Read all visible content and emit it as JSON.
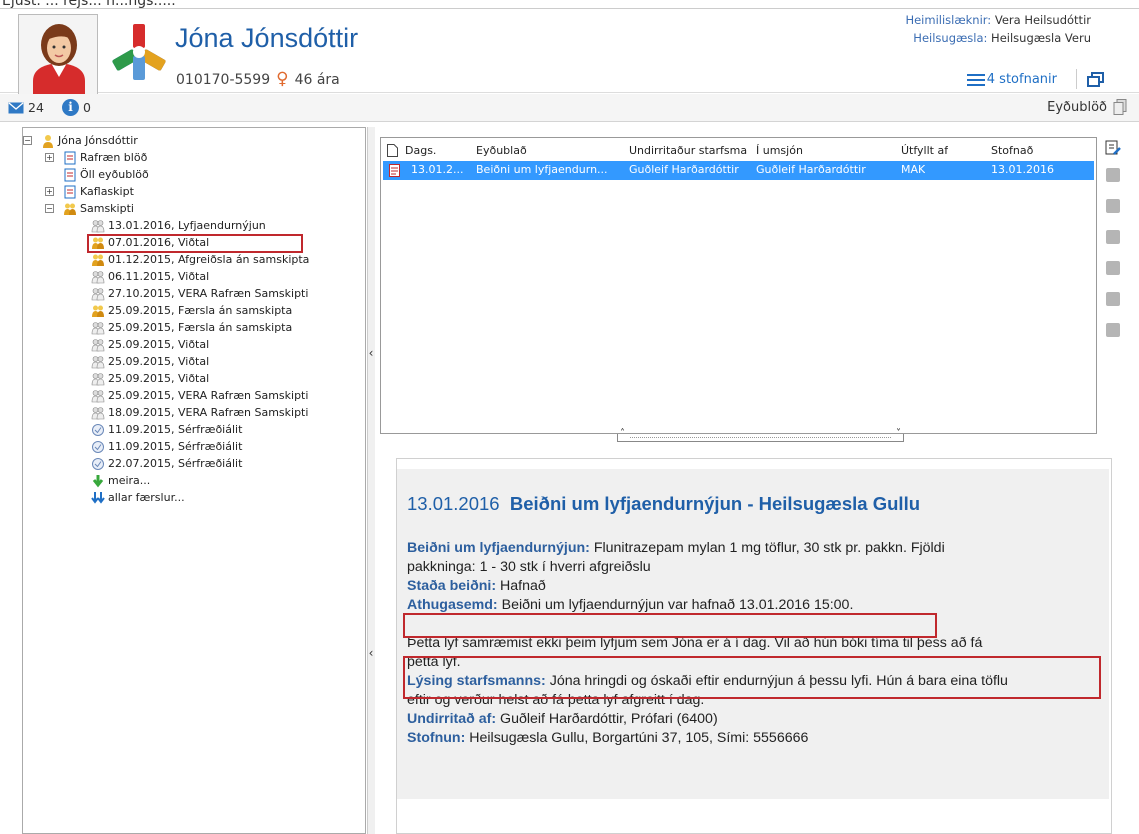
{
  "patient": {
    "name": "Jóna Jónsdóttir",
    "kennitala": "010170-5599",
    "gender_symbol": "♀",
    "age": "46 ára"
  },
  "header_right": {
    "gp_label": "Heimilislæknir:",
    "gp_value": "Vera Heilsudóttir",
    "clinic_label": "Heilsugæsla:",
    "clinic_value": "Heilsugæsla Veru",
    "institutions_link": "4 stofnanir"
  },
  "toolbar": {
    "messages_count": "24",
    "info_count": "0",
    "forms_label": "Eyðublöð"
  },
  "tree": {
    "root": "Jóna Jónsdóttir",
    "groups": [
      "Rafræn blöð",
      "Öll eyðublöð",
      "Kaflaskipt",
      "Samskipti"
    ],
    "entries": [
      "13.01.2016, Lyfjaendurnýjun",
      "07.01.2016, Viðtal",
      "01.12.2015, Afgreiðsla án samskipta",
      "06.11.2015, Viðtal",
      "27.10.2015, VERA Rafræn Samskipti",
      "25.09.2015, Færsla án samskipta",
      "25.09.2015, Færsla án samskipta",
      "25.09.2015, Viðtal",
      "25.09.2015, Viðtal",
      "25.09.2015, Viðtal",
      "25.09.2015, VERA Rafræn Samskipti",
      "18.09.2015, VERA Rafræn Samskipti",
      "11.09.2015, Sérfræðiálit",
      "11.09.2015, Sérfræðiálit",
      "22.07.2015, Sérfræðiálit"
    ],
    "more": "meira...",
    "all": "allar færslur..."
  },
  "list": {
    "columns": [
      "Dags.",
      "Eyðublað",
      "Undirritaður starfsma",
      "Í umsjón",
      "Útfyllt af",
      "Stofnað"
    ],
    "row": [
      "13.01.2...",
      "Beiðni um lyfjaendurn...",
      "Guðleif Harðardóttir",
      "Guðleif Harðardóttir",
      "MAK",
      "13.01.2016"
    ]
  },
  "detail": {
    "date": "13.01.2016",
    "title": "Beiðni um lyfjaendurnýjun - Heilsugæsla Gullu",
    "request_label": "Beiðni um lyfjaendurnýjun:",
    "request_value": "Flunitrazepam mylan 1 mg töflur, 30 stk pr. pakkn. Fjöldi",
    "request_value_2": "pakkninga: 1 - 30 stk í hverri afgreiðslu",
    "status_label": "Staða beiðni:",
    "status_value": "Hafnað",
    "note_label": "Athugasemd:",
    "note_value": "Beiðni um lyfjaendurnýjun var hafnað 13.01.2016 15:00.",
    "note_text_1": "Þetta lyf samræmist ekki þeim lyfjum sem Jóna er á í dag. Vil að hún bóki tíma til þess að fá",
    "note_text_2": "þetta lyf.",
    "staff_label": "Lýsing starfsmanns:",
    "staff_value": "Jóna hringdi og óskaði eftir endurnýjun á þessu lyfi. Hún á bara eina töflu",
    "staff_value_2": "eftir og verður helst að fá þetta lyf afgreitt í dag.",
    "signed_label": "Undirritað af:",
    "signed_value": "Guðleif Harðardóttir, Prófari (6400)",
    "inst_label": "Stofnun:",
    "inst_value": "Heilsugæsla Gullu, Borgartúni 37, 105, Sími: 5556666"
  },
  "colors": {
    "accent_blue": "#1f5fa8",
    "selection": "#3399ff",
    "highlight_red": "#c0282d"
  }
}
